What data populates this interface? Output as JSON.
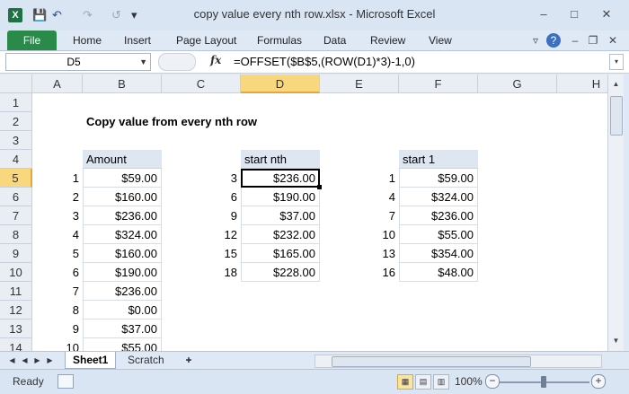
{
  "window": {
    "title": "copy value every nth row.xlsx - Microsoft Excel",
    "app_icon_letter": "X",
    "controls": {
      "minimize": "–",
      "maximize": "□",
      "close": "✕"
    }
  },
  "quick_access": {
    "save": "💾",
    "undo": "↶",
    "redo": "↷",
    "refresh": "↺",
    "customize": "▾"
  },
  "ribbon": {
    "file": "File",
    "tabs": [
      "Home",
      "Insert",
      "Page Layout",
      "Formulas",
      "Data",
      "Review",
      "View"
    ]
  },
  "formula_bar": {
    "name_box": "D5",
    "fx": "fx",
    "formula": "=OFFSET($B$5,(ROW(D1)*3)-1,0)"
  },
  "columns": [
    "A",
    "B",
    "C",
    "D",
    "E",
    "F",
    "G",
    "H"
  ],
  "selected_column": "D",
  "rows": [
    "1",
    "2",
    "3",
    "4",
    "5",
    "6",
    "7",
    "8",
    "9",
    "10",
    "11",
    "12",
    "13",
    "14"
  ],
  "selected_row": "5",
  "sheet": {
    "title": "Copy value from every nth row",
    "amount_header": "Amount",
    "amount_index": [
      "1",
      "2",
      "3",
      "4",
      "5",
      "6",
      "7",
      "8",
      "9",
      "10"
    ],
    "amount_values": [
      "$59.00",
      "$160.00",
      "$236.00",
      "$324.00",
      "$160.00",
      "$190.00",
      "$236.00",
      "$0.00",
      "$37.00",
      "$55.00"
    ],
    "nth_header": "start nth",
    "nth_index": [
      "3",
      "6",
      "9",
      "12",
      "15",
      "18"
    ],
    "nth_values": [
      "$236.00",
      "$190.00",
      "$37.00",
      "$232.00",
      "$165.00",
      "$228.00"
    ],
    "first_header": "start 1",
    "first_index": [
      "1",
      "4",
      "7",
      "10",
      "13",
      "16"
    ],
    "first_values": [
      "$59.00",
      "$324.00",
      "$236.00",
      "$55.00",
      "$354.00",
      "$48.00"
    ]
  },
  "sheet_tabs": {
    "active": "Sheet1",
    "other": "Scratch"
  },
  "status": {
    "ready": "Ready",
    "zoom": "100%",
    "minus": "−",
    "plus": "+"
  }
}
